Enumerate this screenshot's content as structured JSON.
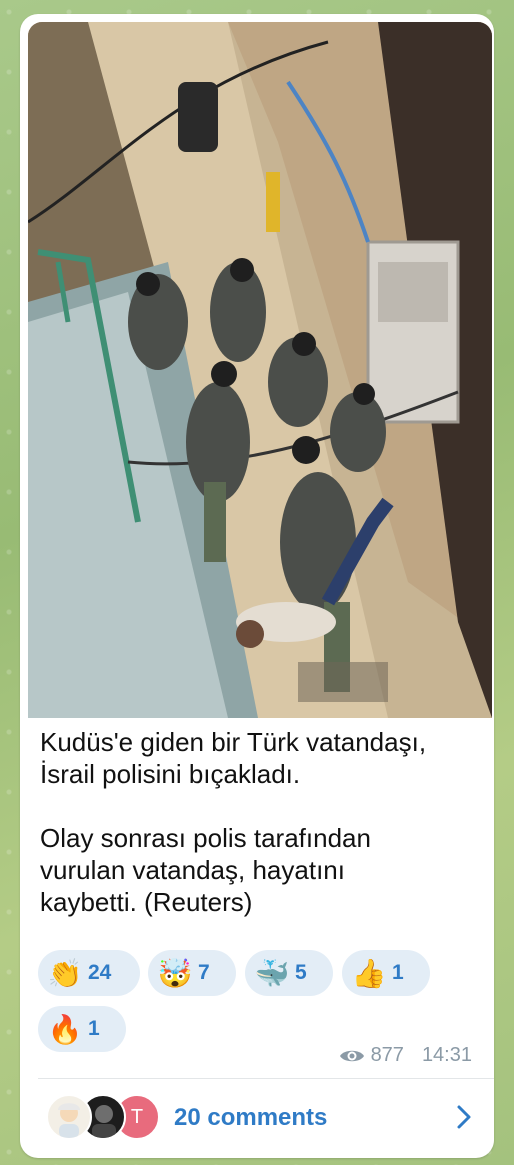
{
  "post": {
    "caption": "Kudüs'e giden bir Türk vatandaşı,\nİsrail polisini bıçakladı.\n\nOlay sonrası polis tarafından\nvurulan vatandaş, hayatını\nkaybetti. (Reuters)"
  },
  "reactions": [
    {
      "emoji": "👏",
      "count": "24",
      "name": "clapping-hands"
    },
    {
      "emoji": "🤯",
      "count": "7",
      "name": "exploding-head"
    },
    {
      "emoji": "🐳",
      "count": "5",
      "name": "whale"
    },
    {
      "emoji": "👍",
      "count": "1",
      "name": "thumbs-up"
    },
    {
      "emoji": "🔥",
      "count": "1",
      "name": "fire"
    }
  ],
  "meta": {
    "views": "877",
    "time": "14:31"
  },
  "comments": {
    "label": "20 comments",
    "avatar_letter": "T"
  },
  "colors": {
    "accent": "#2f7bc6",
    "chip_bg": "#e3edf6",
    "meta_text": "#8b9aa6"
  }
}
